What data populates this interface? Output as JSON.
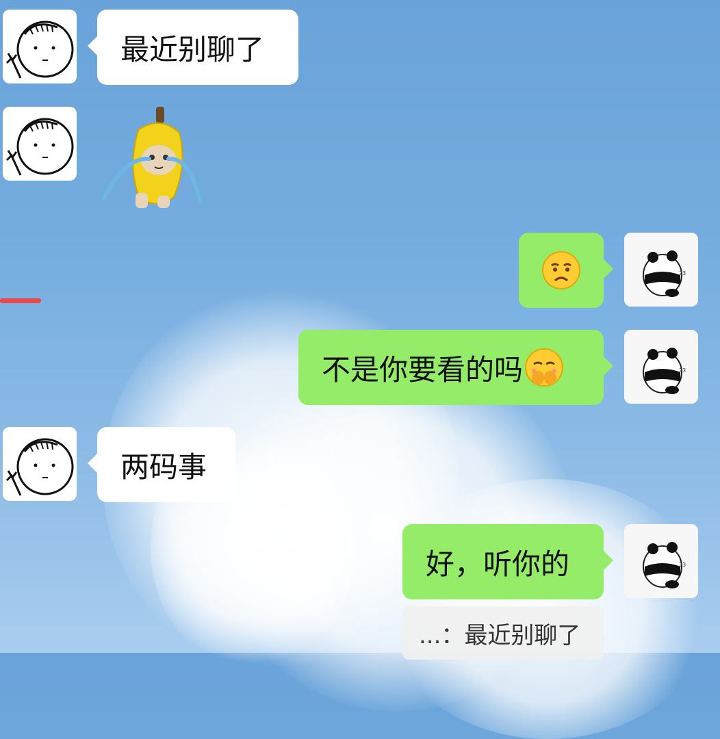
{
  "messages": [
    {
      "side": "left",
      "type": "text",
      "text": "最近别聊了",
      "avatar": "stickman-avatar"
    },
    {
      "side": "left",
      "type": "sticker",
      "sticker": "crying-banana-cat-sticker",
      "avatar": "stickman-avatar"
    },
    {
      "side": "right",
      "type": "emoji",
      "emoji": "sad-face-emoji",
      "avatar": "panda-avatar"
    },
    {
      "side": "right",
      "type": "text",
      "text": "不是你要看的吗",
      "emoji": "covering-mouth-emoji",
      "avatar": "panda-avatar"
    },
    {
      "side": "left",
      "type": "text",
      "text": "两码事",
      "avatar": "stickman-avatar"
    },
    {
      "side": "right",
      "type": "text",
      "text": "好，听你的",
      "avatar": "panda-avatar"
    }
  ],
  "quote": {
    "prefix": "...：",
    "text": "最近别聊了"
  },
  "colors": {
    "right_bubble": "#95ec69",
    "left_bubble": "#ffffff",
    "sky": "#74acdf"
  }
}
